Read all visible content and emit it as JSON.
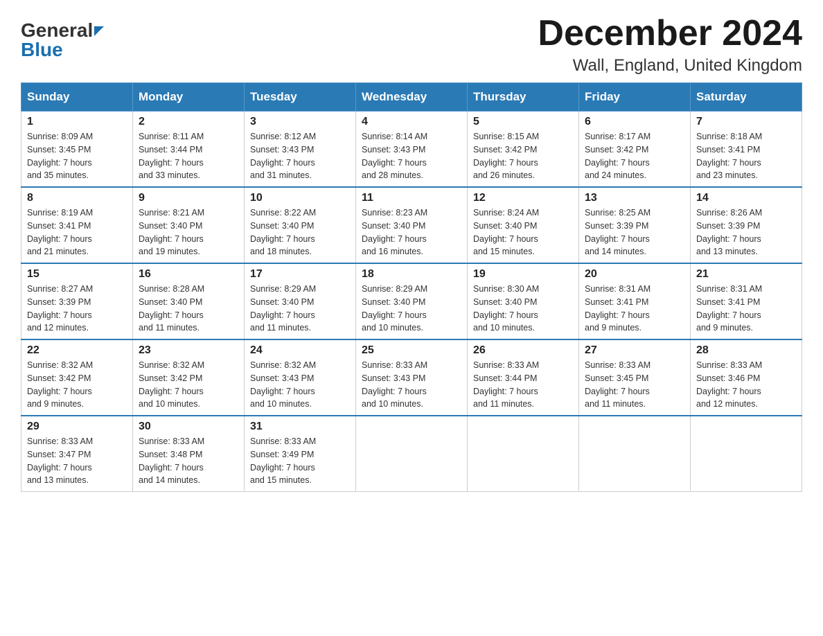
{
  "logo": {
    "general": "General",
    "blue": "Blue"
  },
  "title": {
    "month": "December 2024",
    "location": "Wall, England, United Kingdom"
  },
  "headers": [
    "Sunday",
    "Monday",
    "Tuesday",
    "Wednesday",
    "Thursday",
    "Friday",
    "Saturday"
  ],
  "weeks": [
    [
      {
        "day": "1",
        "info": "Sunrise: 8:09 AM\nSunset: 3:45 PM\nDaylight: 7 hours\nand 35 minutes."
      },
      {
        "day": "2",
        "info": "Sunrise: 8:11 AM\nSunset: 3:44 PM\nDaylight: 7 hours\nand 33 minutes."
      },
      {
        "day": "3",
        "info": "Sunrise: 8:12 AM\nSunset: 3:43 PM\nDaylight: 7 hours\nand 31 minutes."
      },
      {
        "day": "4",
        "info": "Sunrise: 8:14 AM\nSunset: 3:43 PM\nDaylight: 7 hours\nand 28 minutes."
      },
      {
        "day": "5",
        "info": "Sunrise: 8:15 AM\nSunset: 3:42 PM\nDaylight: 7 hours\nand 26 minutes."
      },
      {
        "day": "6",
        "info": "Sunrise: 8:17 AM\nSunset: 3:42 PM\nDaylight: 7 hours\nand 24 minutes."
      },
      {
        "day": "7",
        "info": "Sunrise: 8:18 AM\nSunset: 3:41 PM\nDaylight: 7 hours\nand 23 minutes."
      }
    ],
    [
      {
        "day": "8",
        "info": "Sunrise: 8:19 AM\nSunset: 3:41 PM\nDaylight: 7 hours\nand 21 minutes."
      },
      {
        "day": "9",
        "info": "Sunrise: 8:21 AM\nSunset: 3:40 PM\nDaylight: 7 hours\nand 19 minutes."
      },
      {
        "day": "10",
        "info": "Sunrise: 8:22 AM\nSunset: 3:40 PM\nDaylight: 7 hours\nand 18 minutes."
      },
      {
        "day": "11",
        "info": "Sunrise: 8:23 AM\nSunset: 3:40 PM\nDaylight: 7 hours\nand 16 minutes."
      },
      {
        "day": "12",
        "info": "Sunrise: 8:24 AM\nSunset: 3:40 PM\nDaylight: 7 hours\nand 15 minutes."
      },
      {
        "day": "13",
        "info": "Sunrise: 8:25 AM\nSunset: 3:39 PM\nDaylight: 7 hours\nand 14 minutes."
      },
      {
        "day": "14",
        "info": "Sunrise: 8:26 AM\nSunset: 3:39 PM\nDaylight: 7 hours\nand 13 minutes."
      }
    ],
    [
      {
        "day": "15",
        "info": "Sunrise: 8:27 AM\nSunset: 3:39 PM\nDaylight: 7 hours\nand 12 minutes."
      },
      {
        "day": "16",
        "info": "Sunrise: 8:28 AM\nSunset: 3:40 PM\nDaylight: 7 hours\nand 11 minutes."
      },
      {
        "day": "17",
        "info": "Sunrise: 8:29 AM\nSunset: 3:40 PM\nDaylight: 7 hours\nand 11 minutes."
      },
      {
        "day": "18",
        "info": "Sunrise: 8:29 AM\nSunset: 3:40 PM\nDaylight: 7 hours\nand 10 minutes."
      },
      {
        "day": "19",
        "info": "Sunrise: 8:30 AM\nSunset: 3:40 PM\nDaylight: 7 hours\nand 10 minutes."
      },
      {
        "day": "20",
        "info": "Sunrise: 8:31 AM\nSunset: 3:41 PM\nDaylight: 7 hours\nand 9 minutes."
      },
      {
        "day": "21",
        "info": "Sunrise: 8:31 AM\nSunset: 3:41 PM\nDaylight: 7 hours\nand 9 minutes."
      }
    ],
    [
      {
        "day": "22",
        "info": "Sunrise: 8:32 AM\nSunset: 3:42 PM\nDaylight: 7 hours\nand 9 minutes."
      },
      {
        "day": "23",
        "info": "Sunrise: 8:32 AM\nSunset: 3:42 PM\nDaylight: 7 hours\nand 10 minutes."
      },
      {
        "day": "24",
        "info": "Sunrise: 8:32 AM\nSunset: 3:43 PM\nDaylight: 7 hours\nand 10 minutes."
      },
      {
        "day": "25",
        "info": "Sunrise: 8:33 AM\nSunset: 3:43 PM\nDaylight: 7 hours\nand 10 minutes."
      },
      {
        "day": "26",
        "info": "Sunrise: 8:33 AM\nSunset: 3:44 PM\nDaylight: 7 hours\nand 11 minutes."
      },
      {
        "day": "27",
        "info": "Sunrise: 8:33 AM\nSunset: 3:45 PM\nDaylight: 7 hours\nand 11 minutes."
      },
      {
        "day": "28",
        "info": "Sunrise: 8:33 AM\nSunset: 3:46 PM\nDaylight: 7 hours\nand 12 minutes."
      }
    ],
    [
      {
        "day": "29",
        "info": "Sunrise: 8:33 AM\nSunset: 3:47 PM\nDaylight: 7 hours\nand 13 minutes."
      },
      {
        "day": "30",
        "info": "Sunrise: 8:33 AM\nSunset: 3:48 PM\nDaylight: 7 hours\nand 14 minutes."
      },
      {
        "day": "31",
        "info": "Sunrise: 8:33 AM\nSunset: 3:49 PM\nDaylight: 7 hours\nand 15 minutes."
      },
      null,
      null,
      null,
      null
    ]
  ]
}
